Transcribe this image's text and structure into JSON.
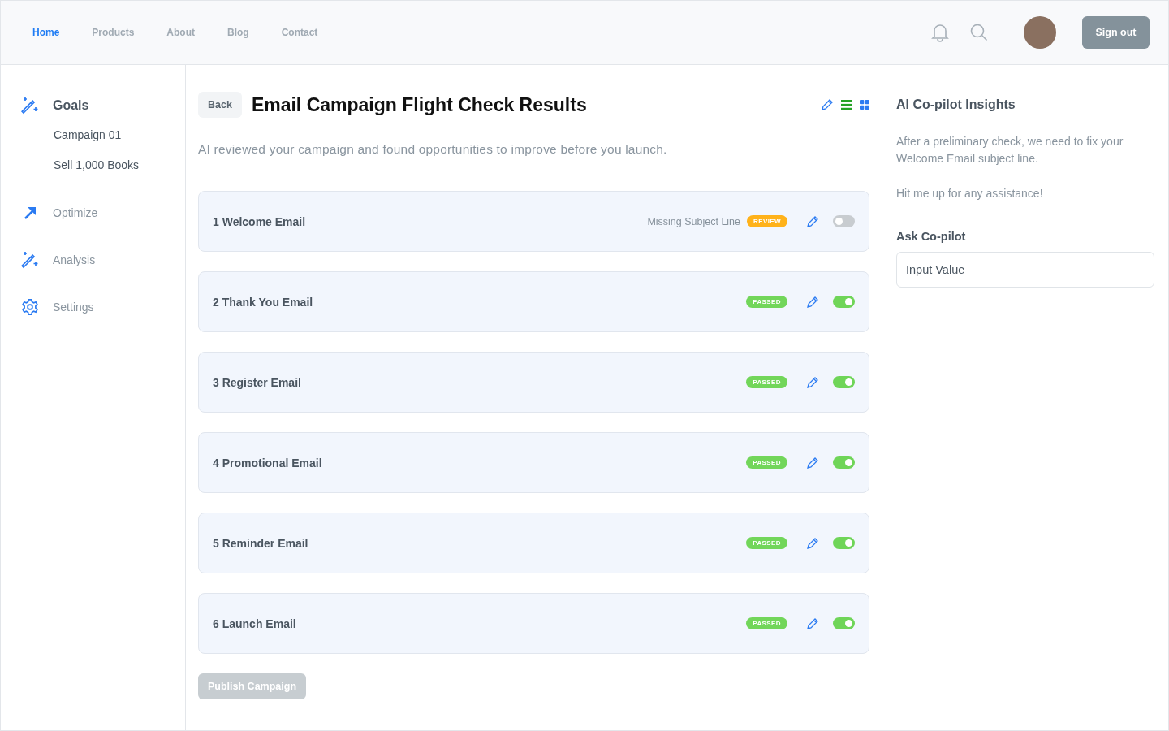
{
  "nav": {
    "items": [
      {
        "label": "Home",
        "selected": true
      },
      {
        "label": "Products",
        "selected": false
      },
      {
        "label": "About",
        "selected": false
      },
      {
        "label": "Blog",
        "selected": false
      },
      {
        "label": "Contact",
        "selected": false
      }
    ],
    "sign_out": "Sign out"
  },
  "sidebar": {
    "items": [
      {
        "label": "Goals",
        "kind": "wand",
        "selected": true,
        "children": [
          {
            "label": "Campaign 01"
          },
          {
            "label": "Sell 1,000 Books"
          }
        ]
      },
      {
        "label": "Optimize",
        "kind": "arrow",
        "selected": false
      },
      {
        "label": "Analysis",
        "kind": "wand",
        "selected": false
      },
      {
        "label": "Settings",
        "kind": "gear",
        "selected": false
      }
    ]
  },
  "main": {
    "back": "Back",
    "title": "Email Campaign Flight Check Results",
    "subtitle": "AI reviewed your campaign and found opportunities to improve before you launch.",
    "emails": [
      {
        "name": "1 Welcome Email",
        "issue": "Missing Subject Line",
        "status": "REVIEW",
        "kind": "review",
        "on": false
      },
      {
        "name": "2 Thank You Email",
        "status": "PASSED",
        "kind": "passed",
        "on": true
      },
      {
        "name": "3 Register Email",
        "status": "PASSED",
        "kind": "passed",
        "on": true
      },
      {
        "name": "4 Promotional Email",
        "status": "PASSED",
        "kind": "passed",
        "on": true
      },
      {
        "name": "5 Reminder Email",
        "status": "PASSED",
        "kind": "passed",
        "on": true
      },
      {
        "name": "6 Launch Email",
        "status": "PASSED",
        "kind": "passed",
        "on": true
      }
    ],
    "publish": {
      "label": "Publish Campaign",
      "disabled": true
    }
  },
  "copilot": {
    "title": "AI Co-pilot Insights",
    "message": "After a preliminary check, we need to fix your Welcome Email subject line.",
    "note": "Hit me up for any assistance!",
    "ask_label": "Ask Co-pilot",
    "input_value": "Input Value"
  }
}
